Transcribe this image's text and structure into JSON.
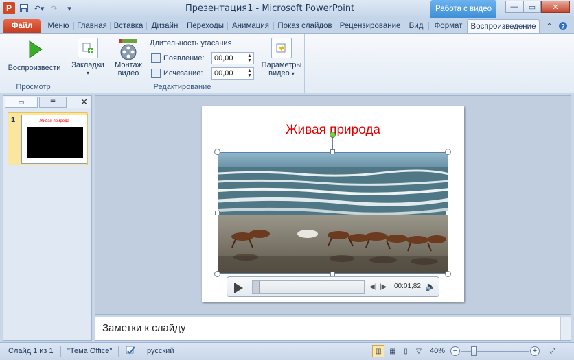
{
  "window": {
    "title": "Презентация1 - Microsoft PowerPoint",
    "context_tab_group": "Работа с видео"
  },
  "tabs": [
    {
      "label": "Файл"
    },
    {
      "label": "Меню"
    },
    {
      "label": "Главная"
    },
    {
      "label": "Вставка"
    },
    {
      "label": "Дизайн"
    },
    {
      "label": "Переходы"
    },
    {
      "label": "Анимация"
    },
    {
      "label": "Показ слайдов"
    },
    {
      "label": "Рецензирование"
    },
    {
      "label": "Вид"
    },
    {
      "label": "Формат"
    },
    {
      "label": "Воспроизведение"
    }
  ],
  "ribbon": {
    "play_label": "Воспроизвести",
    "preview_group": "Просмотр",
    "bookmarks_label": "Закладки",
    "trim_label_1": "Монтаж",
    "trim_label_2": "видео",
    "fade_title": "Длительность угасания",
    "fade_in_label": "Появление:",
    "fade_in_value": "00,00",
    "fade_out_label": "Исчезание:",
    "fade_out_value": "00,00",
    "editing_group": "Редактирование",
    "options_label_1": "Параметры",
    "options_label_2": "видео"
  },
  "slides_panel": {
    "slide_number": "1",
    "thumb_title": "Живая природа"
  },
  "slide": {
    "title": "Живая природа",
    "video_time": "00:01,82",
    "progress": 0.06
  },
  "notes": {
    "placeholder": "Заметки к слайду"
  },
  "status": {
    "slide_info": "Слайд 1 из 1",
    "theme": "\"Тема Office\"",
    "language": "русский",
    "zoom": "40%"
  },
  "colors": {
    "title_red": "#e00000",
    "file_tab": "#c33b1d",
    "context_tab": "#3f8fd6"
  }
}
